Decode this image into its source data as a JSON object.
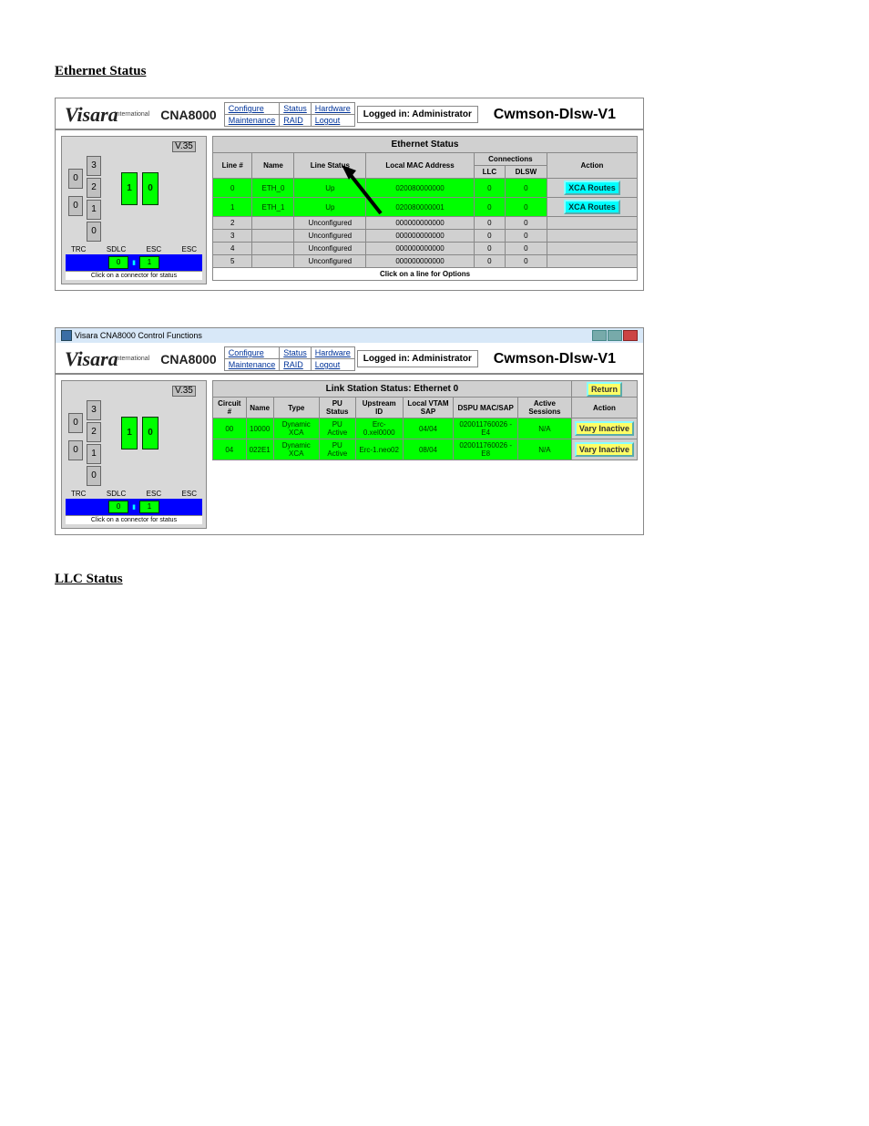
{
  "section1_title": "Ethernet Status",
  "section2_title": "LLC Status",
  "browser_title": "Visara CNA8000 Control Functions",
  "brand": "Visara",
  "brand_tag": "International",
  "model": "CNA8000",
  "nav": {
    "r1c1": "Configure",
    "r1c2": "Status",
    "r1c3": "Hardware",
    "r2c1": "Maintenance",
    "r2c2": "RAID",
    "r2c3": "Logout"
  },
  "loggedin": "Logged in: Administrator",
  "host": "Cwmson-Dlsw-V1",
  "hw": {
    "v35": "V.35",
    "s3": "3",
    "s2": "2",
    "s1": "1",
    "s0": "0",
    "left0a": "0",
    "left0b": "0",
    "g1": "1",
    "g0": "0",
    "trc": "TRC",
    "sdlc": "SDLC",
    "esc1": "ESC",
    "esc2": "ESC",
    "b0": "0",
    "b1": "1",
    "hint": "Click on a connector for status"
  },
  "eth": {
    "title": "Ethernet Status",
    "col_line": "Line #",
    "col_name": "Name",
    "col_status": "Line Status",
    "col_mac": "Local MAC Address",
    "col_conn": "Connections",
    "col_llc": "LLC",
    "col_dlsw": "DLSW",
    "col_action": "Action",
    "footer": "Click on a line for Options",
    "rows": [
      {
        "line": "0",
        "name": "ETH_0",
        "status": "Up",
        "mac": "020080000000",
        "llc": "0",
        "dlsw": "0",
        "action": "XCA Routes",
        "green": true
      },
      {
        "line": "1",
        "name": "ETH_1",
        "status": "Up",
        "mac": "020080000001",
        "llc": "0",
        "dlsw": "0",
        "action": "XCA Routes",
        "green": true
      },
      {
        "line": "2",
        "name": "",
        "status": "Unconfigured",
        "mac": "000000000000",
        "llc": "0",
        "dlsw": "0",
        "action": "",
        "green": false
      },
      {
        "line": "3",
        "name": "",
        "status": "Unconfigured",
        "mac": "000000000000",
        "llc": "0",
        "dlsw": "0",
        "action": "",
        "green": false
      },
      {
        "line": "4",
        "name": "",
        "status": "Unconfigured",
        "mac": "000000000000",
        "llc": "0",
        "dlsw": "0",
        "action": "",
        "green": false
      },
      {
        "line": "5",
        "name": "",
        "status": "Unconfigured",
        "mac": "000000000000",
        "llc": "0",
        "dlsw": "0",
        "action": "",
        "green": false
      }
    ]
  },
  "link": {
    "title": "Link Station Status: Ethernet 0",
    "return": "Return",
    "col_circuit": "Circuit #",
    "col_name": "Name",
    "col_type": "Type",
    "col_pu": "PU Status",
    "col_up": "Upstream ID",
    "col_vtam": "Local VTAM SAP",
    "col_dspu": "DSPU MAC/SAP",
    "col_sess": "Active Sessions",
    "col_action": "Action",
    "rows": [
      {
        "circuit": "00",
        "name": "10000",
        "type": "Dynamic XCA",
        "pu": "PU Active",
        "up": "Erc-0.xel0000",
        "vtam": "04/04",
        "dspu": "020011760026 - E4",
        "sess": "N/A",
        "action": "Vary Inactive"
      },
      {
        "circuit": "04",
        "name": "022E1",
        "type": "Dynamic XCA",
        "pu": "PU Active",
        "up": "Erc-1.neo02",
        "vtam": "08/04",
        "dspu": "020011760026 - E8",
        "sess": "N/A",
        "action": "Vary Inactive"
      }
    ]
  }
}
